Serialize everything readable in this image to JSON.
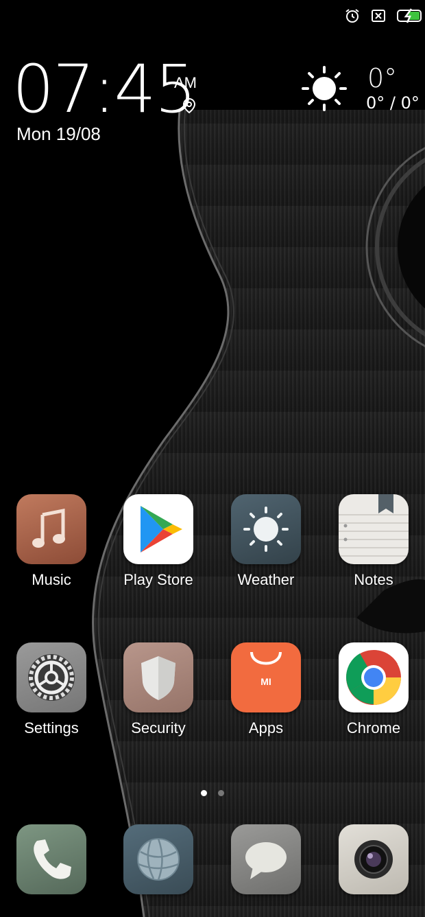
{
  "status_bar": {
    "icons": [
      "alarm-icon",
      "sim-off-icon",
      "battery-charging-icon"
    ]
  },
  "clock": {
    "time": "07:45",
    "ampm": "AM",
    "date": "Mon 19/08",
    "location_icon": "location-pin-icon"
  },
  "weather_widget": {
    "icon": "sun-icon",
    "temp": "0°",
    "range": "0° / 0°"
  },
  "apps_row1": [
    {
      "label": "Music",
      "icon": "music-note-icon"
    },
    {
      "label": "Play Store",
      "icon": "play-store-icon"
    },
    {
      "label": "Weather",
      "icon": "sun-icon"
    },
    {
      "label": "Notes",
      "icon": "notepad-icon"
    }
  ],
  "apps_row2": [
    {
      "label": "Settings",
      "icon": "gear-icon"
    },
    {
      "label": "Security",
      "icon": "shield-icon"
    },
    {
      "label": "Apps",
      "icon": "shopping-bag-icon"
    },
    {
      "label": "Chrome",
      "icon": "chrome-icon"
    }
  ],
  "page_indicator": {
    "pages": 2,
    "current": 1
  },
  "dock": [
    {
      "icon": "phone-icon"
    },
    {
      "icon": "browser-globe-icon"
    },
    {
      "icon": "messages-icon"
    },
    {
      "icon": "camera-icon"
    }
  ],
  "colors": {
    "music_bg": "#a8614a",
    "weather_bg": "#3f4f58",
    "apps_bg": "#f16b3e",
    "settings_bg": "#8a8a8a",
    "security_bg": "#a8847a"
  }
}
